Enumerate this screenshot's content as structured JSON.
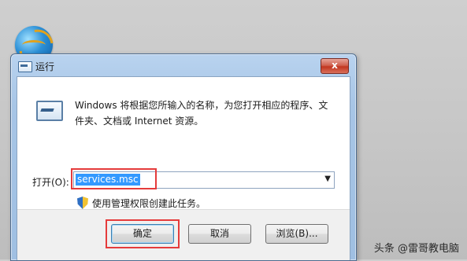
{
  "desktop": {
    "icon": "globe-icon"
  },
  "window": {
    "title": "运行",
    "title_icon": "run-window-icon",
    "close_label": "x",
    "description": "Windows 将根据您所输入的名称，为您打开相应的程序、文件夹、文档或 Internet 资源。",
    "open_label": "打开(O):",
    "open_value": "services.msc",
    "dropdown_arrow": "▼",
    "admin_note": "使用管理权限创建此任务。",
    "buttons": {
      "ok": "确定",
      "cancel": "取消",
      "browse": "浏览(B)..."
    },
    "highlight_color": "#e53b3b"
  },
  "watermark": "头条 @雷哥教电脑"
}
